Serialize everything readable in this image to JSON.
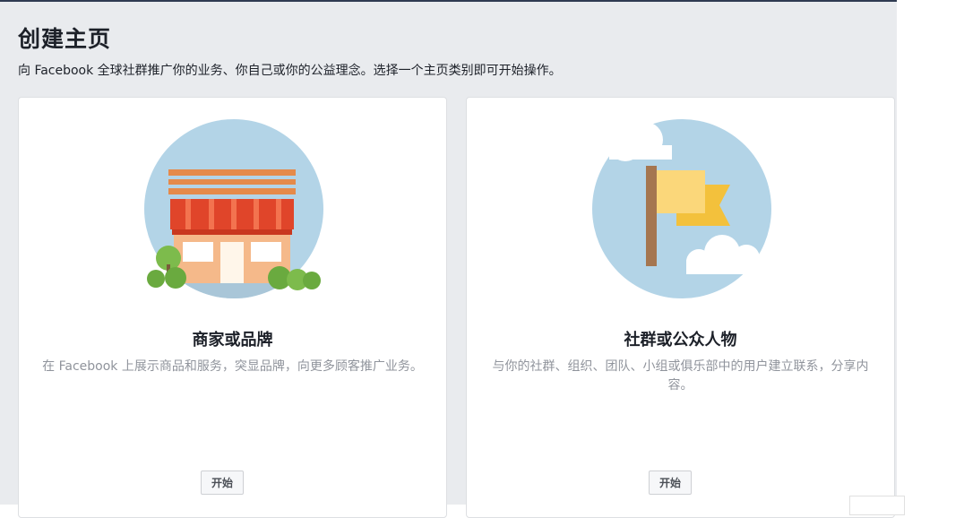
{
  "header": {
    "title": "创建主页",
    "subtitle": "向 Facebook 全球社群推广你的业务、你自己或你的公益理念。选择一个主页类别即可开始操作。"
  },
  "cards": [
    {
      "title": "商家或品牌",
      "description": "在 Facebook 上展示商品和服务，突显品牌，向更多顾客推广业务。",
      "button_label": "开始",
      "icon": "storefront-icon"
    },
    {
      "title": "社群或公众人物",
      "description": "与你的社群、组织、团队、小组或俱乐部中的用户建立联系，分享内容。",
      "button_label": "开始",
      "icon": "flag-icon"
    }
  ],
  "colors": {
    "background": "#e9ebee",
    "card": "#ffffff",
    "illustration_sky": "#b3d4e7",
    "awning_red": "#e0452a",
    "store_orange": "#f0a56b",
    "flag_yellow": "#f8d474"
  }
}
